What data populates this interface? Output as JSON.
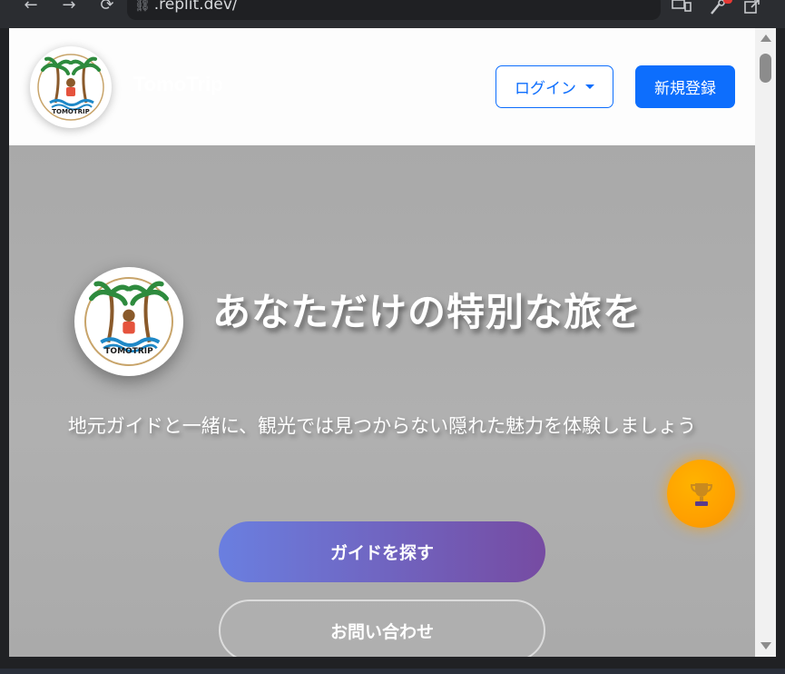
{
  "browser": {
    "url": ".replit.dev/",
    "back_icon": "←",
    "forward_icon": "→",
    "reload_icon": "⟳",
    "link_icon": "🔗"
  },
  "header": {
    "logo_text": "TOMOTRIP",
    "site_name": "TomoTrip",
    "login_label": "ログイン",
    "signup_label": "新規登録"
  },
  "hero": {
    "logo_text": "TOMOTRIP",
    "title": "あなただけの特別な旅を",
    "subtitle": "地元ガイドと一緒に、観光では見つからない隠れた魅力を体験しましょう",
    "primary_cta": "ガイドを探す",
    "secondary_cta": "お問い合わせ"
  },
  "colors": {
    "accent": "#0d6efd",
    "cta_gradient_start": "#6a7fe0",
    "cta_gradient_end": "#764ba2",
    "trophy": "#ffa000"
  }
}
